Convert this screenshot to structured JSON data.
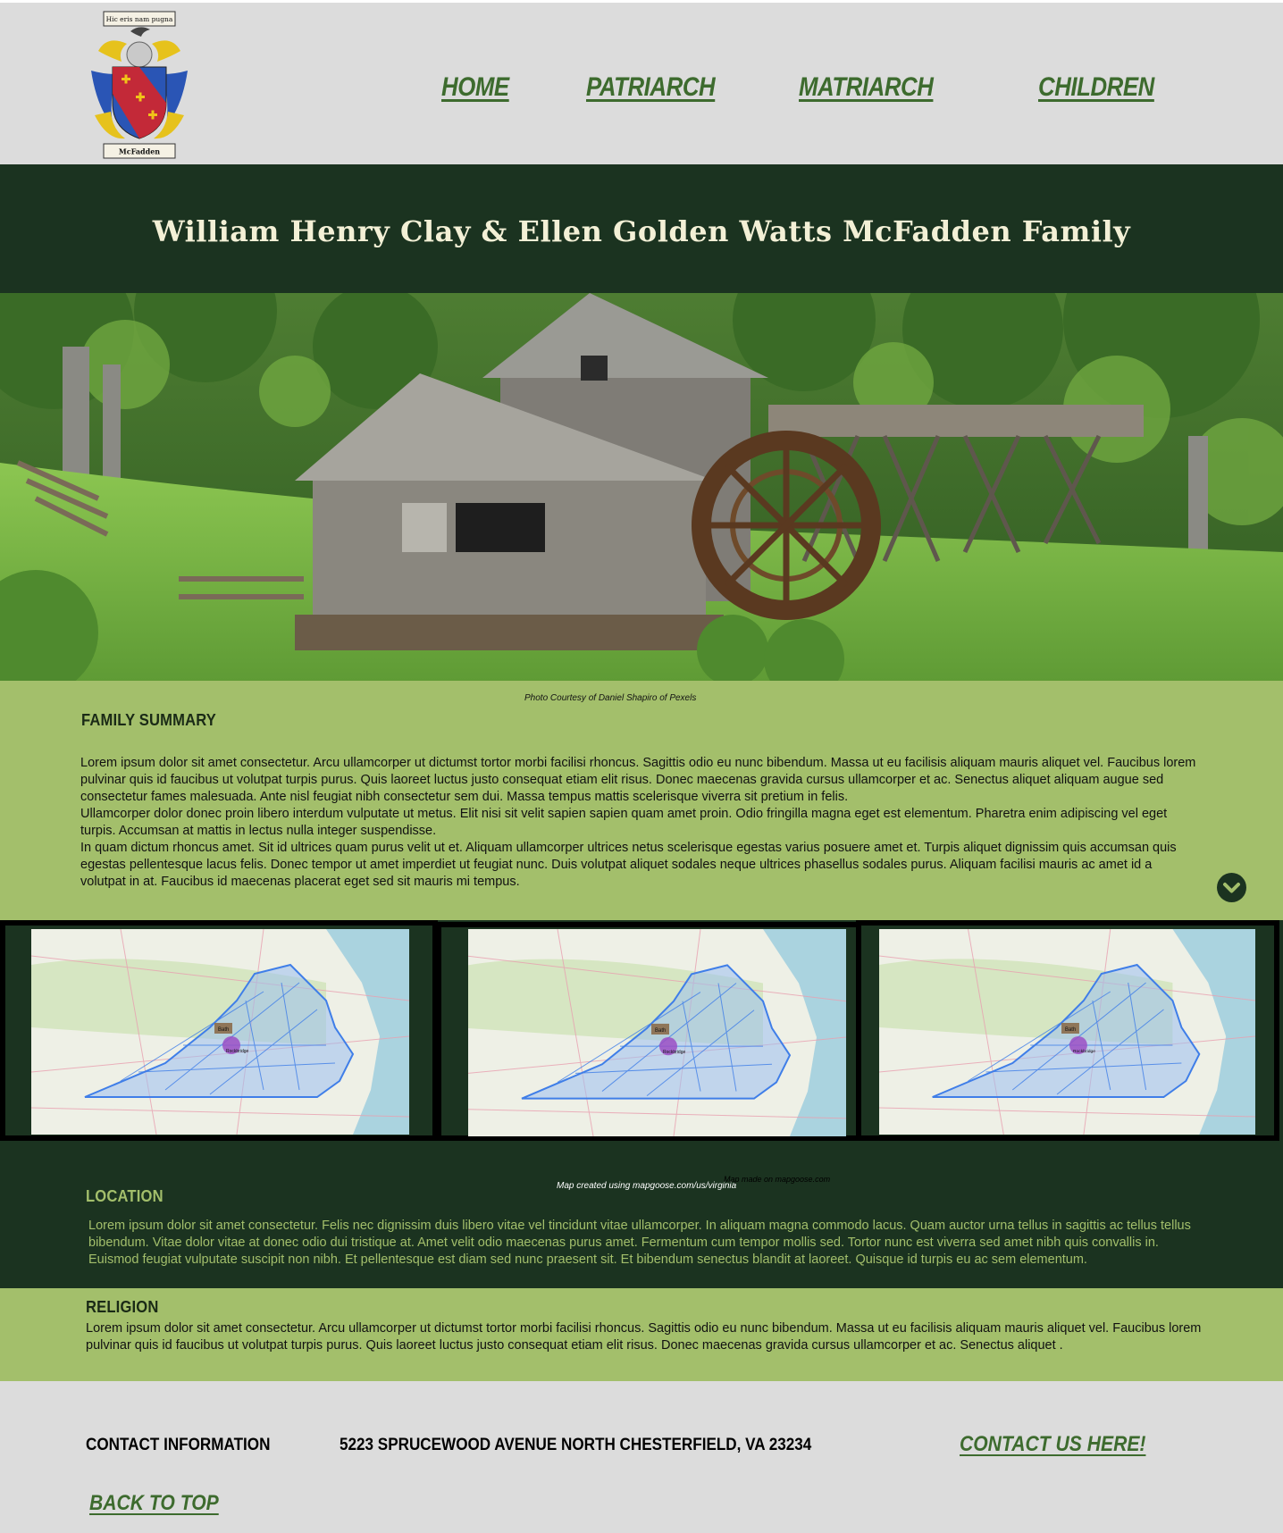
{
  "header": {
    "crest_motto": "Hic eris nam pugna",
    "crest_name": "McFadden",
    "nav": [
      "HOME",
      "PATRIARCH",
      "MATRIARCH",
      "CHILDREN"
    ]
  },
  "title": "William Henry Clay  & Ellen Golden Watts McFadden Family",
  "hero": {
    "caption": "Photo Courtesy of Daniel Shapiro of Pexels"
  },
  "summary": {
    "heading": "FAMILY SUMMARY",
    "paragraphs": [
      "Lorem ipsum dolor sit amet consectetur. Arcu ullamcorper ut dictumst tortor morbi facilisi rhoncus. Sagittis odio eu nunc bibendum. Massa ut eu facilisis aliquam mauris aliquet vel. Faucibus lorem pulvinar quis id faucibus ut volutpat turpis purus. Quis laoreet luctus justo consequat etiam elit risus. Donec maecenas gravida cursus ullamcorper et ac. Senectus aliquet aliquam augue sed consectetur fames malesuada. Ante nisl feugiat nibh consectetur sem dui. Massa tempus mattis scelerisque viverra sit pretium in felis.",
      "Ullamcorper dolor donec proin libero interdum vulputate ut metus. Elit nisi sit velit sapien sapien quam amet proin. Odio fringilla magna eget est elementum. Pharetra enim adipiscing vel eget turpis. Accumsan at mattis in lectus nulla integer suspendisse.",
      "In quam dictum rhoncus amet. Sit id ultrices quam purus velit ut et. Aliquam ullamcorper ultrices netus scelerisque egestas varius posuere amet et. Turpis aliquet dignissim quis accumsan quis egestas pellentesque lacus felis. Donec tempor ut amet imperdiet ut feugiat nunc. Duis volutpat aliquet sodales neque ultrices phasellus sodales purus. Aliquam facilisi mauris ac amet id a volutpat in at. Faucibus id maecenas placerat eget sed sit mauris mi tempus."
    ],
    "scroll_icon": "chevron-down-icon"
  },
  "maps": {
    "pin_label": "Bath",
    "pin_label_2": "Rockbridge",
    "caption": "Map created using mapgoose.com/us/virginia",
    "caption_2": "Map made on mapgoose.com"
  },
  "location": {
    "heading": "LOCATION",
    "text": "Lorem ipsum dolor sit amet consectetur. Felis nec dignissim duis libero vitae vel tincidunt vitae ullamcorper. In aliquam magna commodo lacus. Quam auctor urna tellus in sagittis ac tellus tellus bibendum. Vitae dolor vitae at donec odio dui tristique at. Amet velit odio maecenas purus amet. Fermentum cum tempor mollis sed. Tortor nunc est viverra sed amet nibh quis convallis in. Euismod feugiat vulputate suscipit non nibh. Et pellentesque est diam sed nunc praesent sit. Et bibendum senectus blandit at laoreet. Quisque id turpis eu ac sem elementum."
  },
  "religion": {
    "heading": "RELIGION",
    "text": "Lorem ipsum dolor sit amet consectetur. Arcu ullamcorper ut dictumst tortor morbi facilisi rhoncus. Sagittis odio eu nunc bibendum. Massa ut eu facilisis aliquam mauris aliquet vel. Faucibus lorem pulvinar quis id faucibus ut volutpat turpis purus. Quis laoreet luctus justo consequat etiam elit risus. Donec maecenas gravida cursus ullamcorper et ac. Senectus aliquet ."
  },
  "footer": {
    "contact_heading": "CONTACT INFORMATION",
    "address": "5223 SPRUCEWOOD AVENUE NORTH CHESTERFIELD, VA 23234",
    "contact_link": "CONTACT US HERE!",
    "back_to_top": "BACK TO TOP"
  },
  "colors": {
    "dark_green": "#1b3320",
    "light_green": "#a3bf6b",
    "link_green": "#3d6b2e",
    "header_gray": "#dcdcdc"
  }
}
